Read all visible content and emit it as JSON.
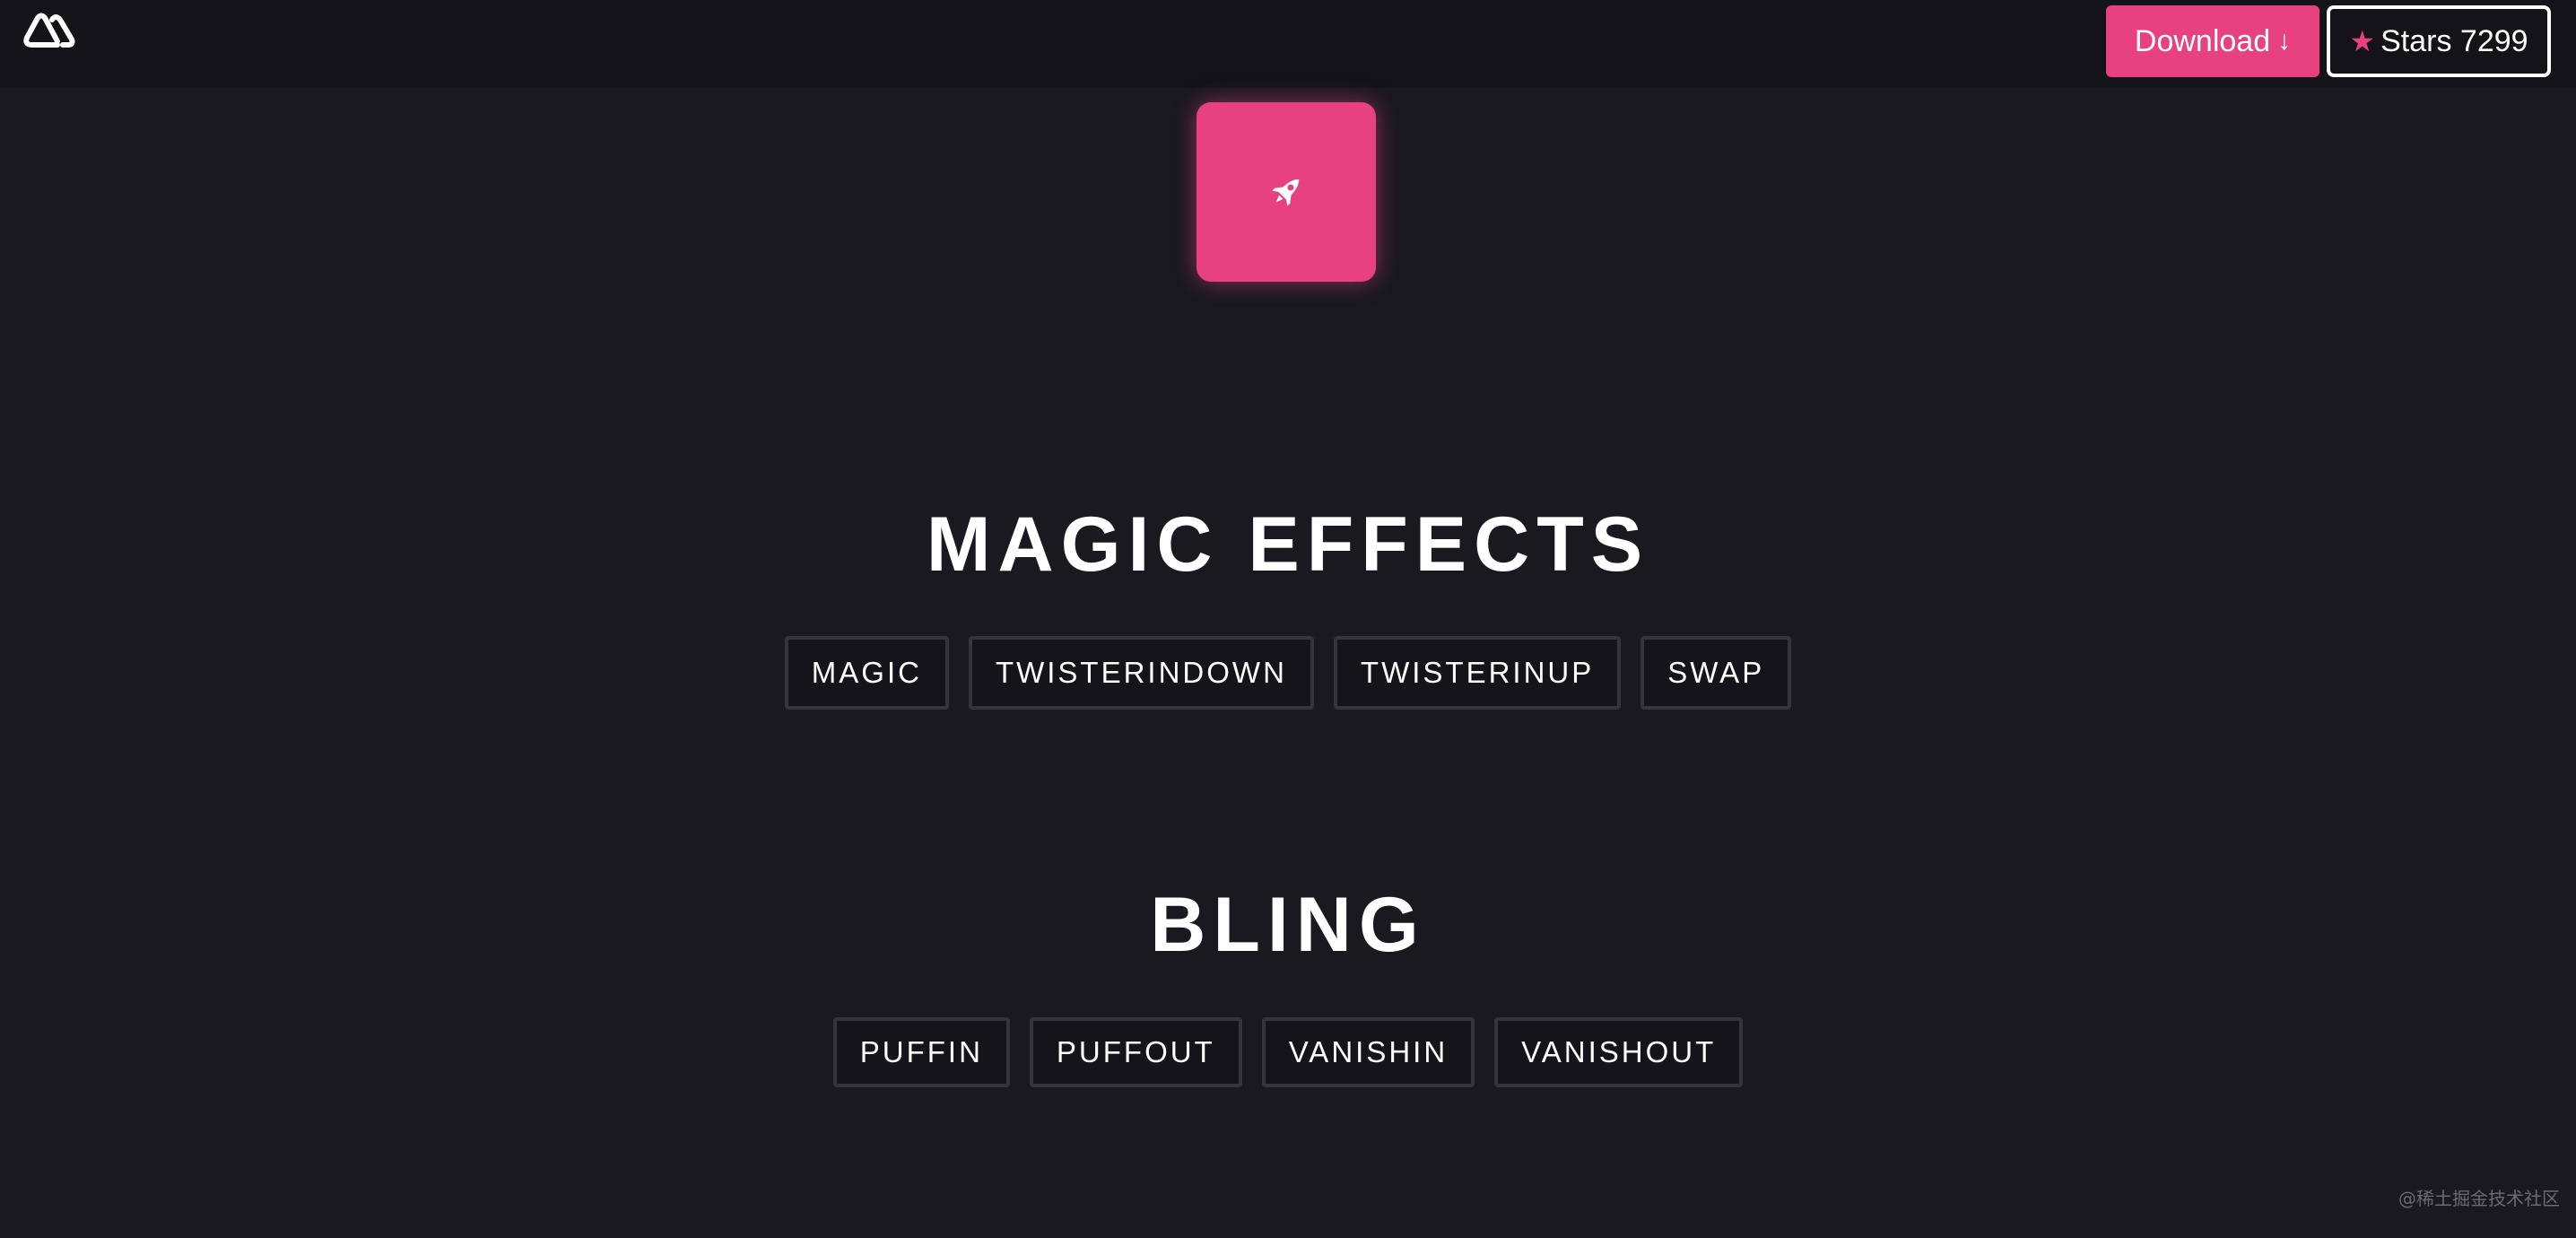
{
  "header": {
    "logo_icon": "triangle-loop-logo-icon",
    "download_label": "Download",
    "download_icon": "arrow-down-icon",
    "stars_icon": "star-icon",
    "stars_label": "Stars 7299"
  },
  "demo": {
    "icon": "rocket-icon",
    "color": "#e8427e"
  },
  "sections": [
    {
      "title": "MAGIC EFFECTS",
      "buttons": [
        "MAGIC",
        "TWISTERINDOWN",
        "TWISTERINUP",
        "SWAP"
      ]
    },
    {
      "title": "BLING",
      "buttons": [
        "PUFFIN",
        "PUFFOUT",
        "VANISHIN",
        "VANISHOUT"
      ]
    }
  ],
  "watermark": "@稀土掘金技术社区",
  "colors": {
    "accent": "#e8427e",
    "background": "#1a1920",
    "header": "#131318",
    "button_border": "#35343b"
  }
}
